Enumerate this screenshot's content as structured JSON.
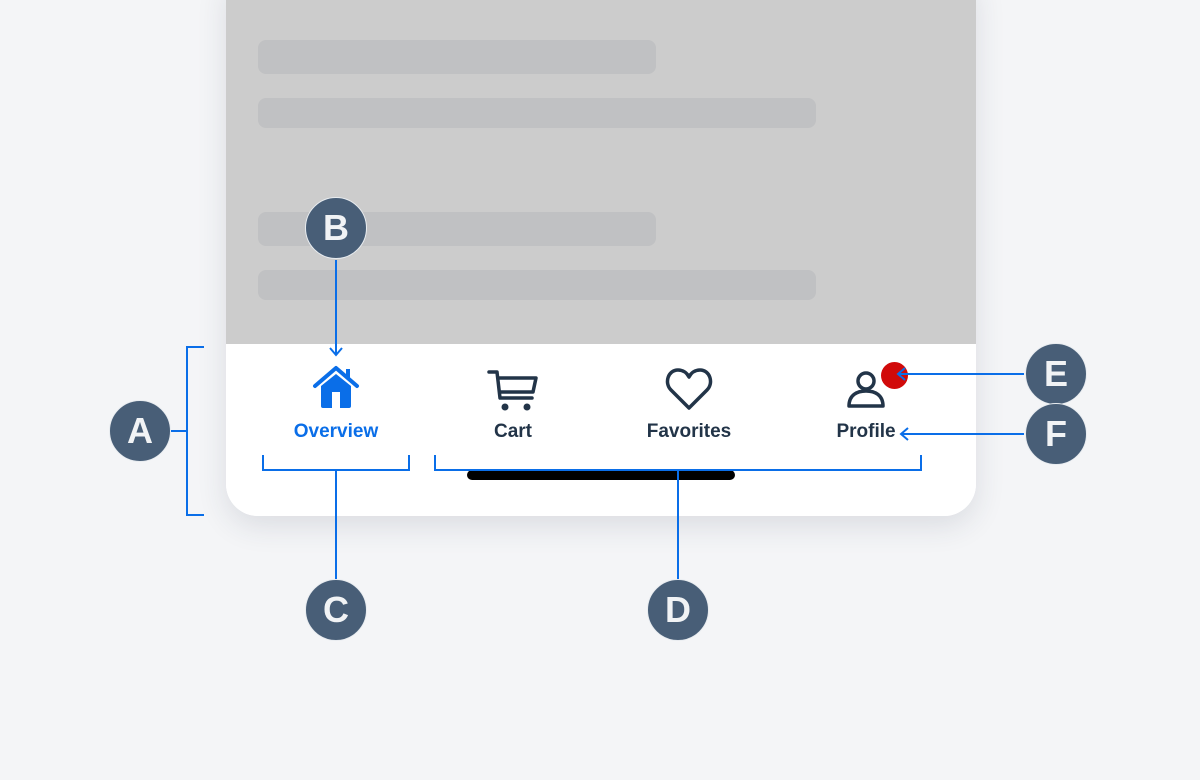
{
  "tab_bar": {
    "tabs": [
      {
        "label": "Overview",
        "icon": "home-icon",
        "active": true
      },
      {
        "label": "Cart",
        "icon": "cart-icon",
        "active": false
      },
      {
        "label": "Favorites",
        "icon": "heart-icon",
        "active": false
      },
      {
        "label": "Profile",
        "icon": "person-icon",
        "active": false,
        "badge": true
      }
    ]
  },
  "colors": {
    "accent": "#0a6ee8",
    "text": "#223448",
    "badge": "#d10a0a",
    "callout": "#485e77",
    "overlay": "#cccccc",
    "skeleton": "#c0c1c3"
  },
  "callouts": {
    "a": "A",
    "b": "B",
    "c": "C",
    "d": "D",
    "e": "E",
    "f": "F"
  }
}
